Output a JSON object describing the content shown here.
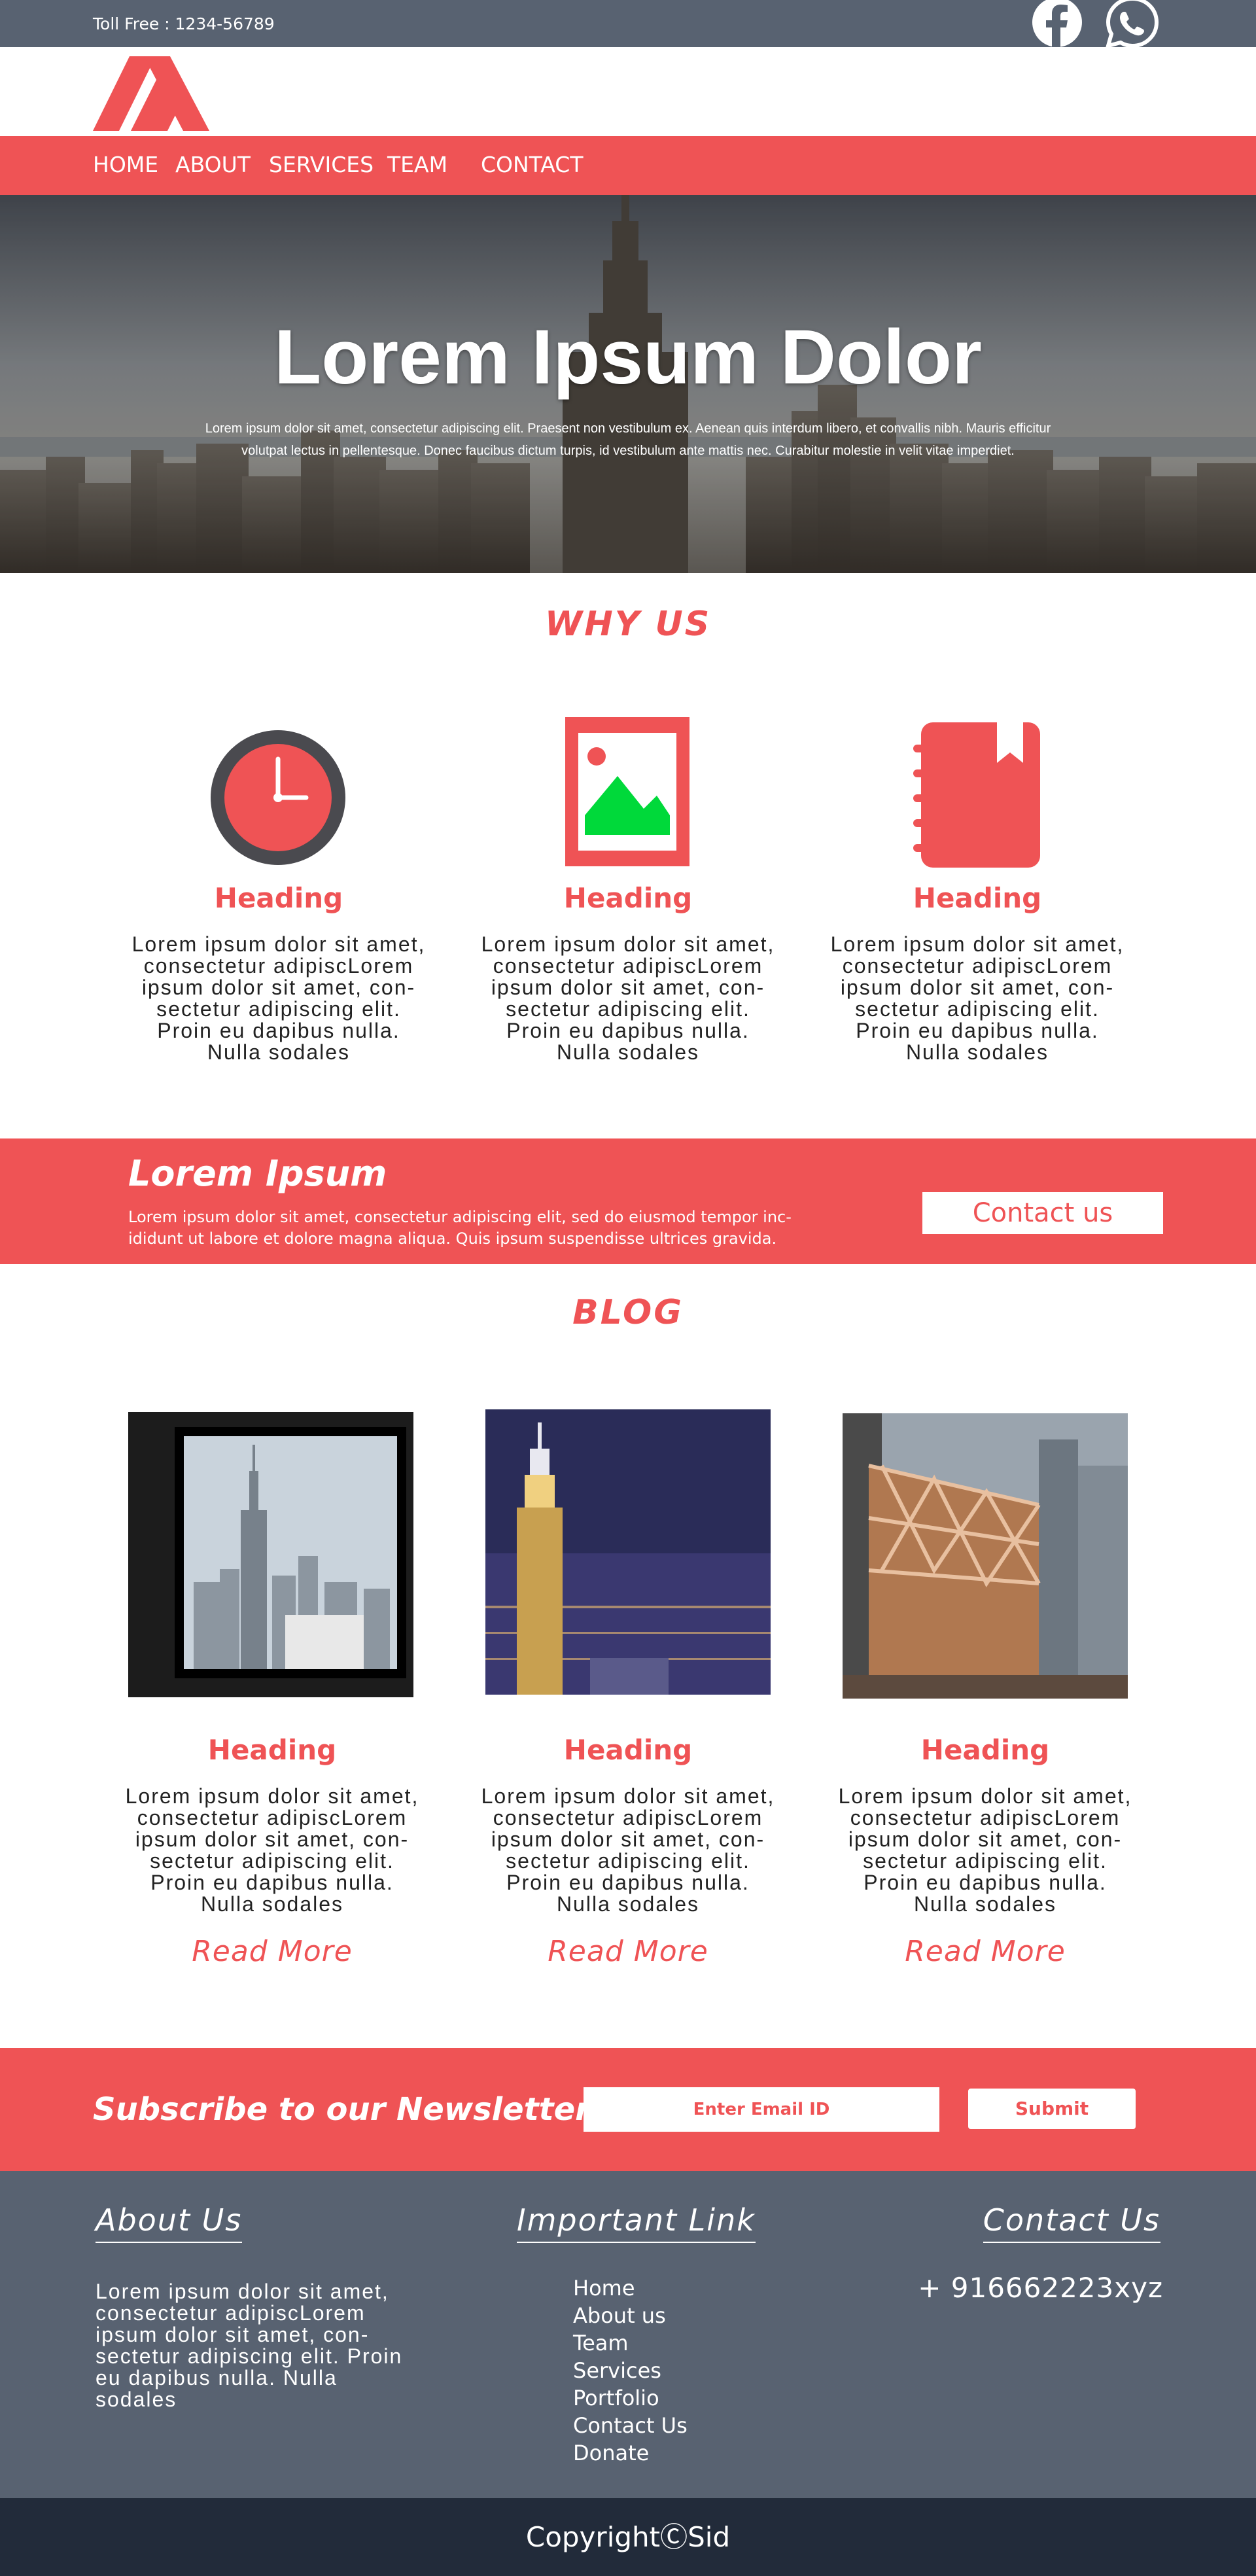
{
  "topbar": {
    "toll_free": "Toll Free : 1234-56789",
    "social_icons": [
      "facebook-icon",
      "whatsapp-icon"
    ]
  },
  "nav": {
    "items": [
      "HOME",
      "ABOUT",
      "SERVICES",
      "TEAM",
      "CONTACT"
    ]
  },
  "hero": {
    "title": "Lorem Ipsum Dolor",
    "text": "Lorem ipsum dolor sit amet, consectetur adipiscing elit. Praesent non vestibulum ex. Aenean quis interdum libero, et convallis nibh. Mauris efficitur volutpat lectus in pellentesque. Donec faucibus dictum turpis, id vestibulum ante mattis nec. Curabitur molestie in velit vitae imperdiet."
  },
  "why_us": {
    "title": "WHY US",
    "items": [
      {
        "icon": "clock-icon",
        "heading": "Heading",
        "text": "Lorem ipsum dolor sit amet, consectetur adipiscLorem ipsum dolor sit amet, con-sectetur adipiscing elit. Proin eu dapibus nulla. Nulla sodales"
      },
      {
        "icon": "image-icon",
        "heading": "Heading",
        "text": "Lorem ipsum dolor sit amet, consectetur adipiscLorem ipsum dolor sit amet, con-sectetur adipiscing elit. Proin eu dapibus nulla. Nulla sodales"
      },
      {
        "icon": "notebook-icon",
        "heading": "Heading",
        "text": "Lorem ipsum dolor sit amet, consectetur adipiscLorem ipsum dolor sit amet, con-sectetur adipiscing elit. Proin eu dapibus nulla. Nulla sodales"
      }
    ]
  },
  "cta": {
    "title": "Lorem Ipsum",
    "text": "Lorem ipsum dolor sit amet, consectetur adipiscing elit, sed do eiusmod tempor inc-ididunt ut labore et dolore magna aliqua. Quis ipsum suspendisse ultrices gravida.",
    "button": "Contact us"
  },
  "blog": {
    "title": "BLOG",
    "posts": [
      {
        "heading": "Heading",
        "text": "Lorem ipsum dolor sit amet, consectetur adipiscLorem ipsum dolor sit amet, con-sectetur adipiscing elit. Proin eu dapibus nulla. Nulla sodales",
        "read_more": "Read More"
      },
      {
        "heading": "Heading",
        "text": "Lorem ipsum dolor sit amet, consectetur adipiscLorem ipsum dolor sit amet, con-sectetur adipiscing elit. Proin eu dapibus nulla. Nulla sodales",
        "read_more": "Read More"
      },
      {
        "heading": "Heading",
        "text": "Lorem ipsum dolor sit amet, consectetur adipiscLorem ipsum dolor sit amet, con-sectetur adipiscing elit. Proin eu dapibus nulla. Nulla sodales",
        "read_more": "Read More"
      }
    ]
  },
  "newsletter": {
    "title": "Subscribe to our Newsletter",
    "placeholder": "Enter Email ID",
    "button": "Submit"
  },
  "footer": {
    "about_title": "About Us",
    "about_text": "Lorem ipsum dolor sit amet, consectetur adipiscLorem ipsum dolor sit amet, con-sectetur adipiscing elit. Proin eu dapibus nulla. Nulla sodales",
    "links_title": "Important Link",
    "links": [
      "Home",
      "About us",
      "Team",
      "Services",
      "Portfolio",
      "Contact Us",
      "Donate"
    ],
    "contact_title": "Contact Us",
    "phone": "+ 916662223xyz"
  },
  "copyright": "CopyrightⒸSid",
  "colors": {
    "accent": "#ef5355",
    "slate": "#586271",
    "dark": "#222b3a",
    "green": "#00d93a"
  }
}
